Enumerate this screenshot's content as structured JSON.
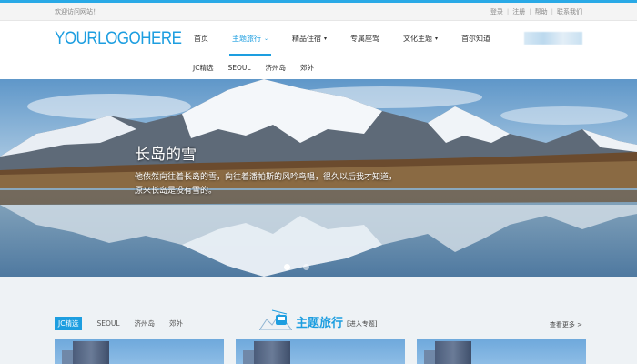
{
  "topbar": {
    "welcome": "欢迎访问网站！",
    "links": [
      "登录",
      "注册",
      "帮助",
      "联系我们"
    ]
  },
  "header": {
    "logo": "YOURLOGOHERE",
    "nav": [
      {
        "label": "首页",
        "chevron": false,
        "active": false
      },
      {
        "label": "主题旅行",
        "chevron": true,
        "active": true
      },
      {
        "label": "精品住宿",
        "chevron": true,
        "active": false
      },
      {
        "label": "专属座驾",
        "chevron": false,
        "active": false
      },
      {
        "label": "文化主题",
        "chevron": true,
        "active": false
      },
      {
        "label": "首尔知道",
        "chevron": false,
        "active": false
      }
    ]
  },
  "subnav": [
    "JC精选",
    "SEOUL",
    "济州岛",
    "郊外"
  ],
  "hero": {
    "title": "长岛的雪",
    "line1": "他依然向往着长岛的雪，向往着潘帕斯的风吟鸟唱，很久以后我才知道，",
    "line2": "原来长岛是没有雪的。",
    "slides": 2,
    "current": 1
  },
  "section": {
    "tabs": [
      "JC精选",
      "SEOUL",
      "济州岛",
      "郊外"
    ],
    "title": "主题旅行",
    "enter": "[进入专题]",
    "more": "查看更多 >"
  },
  "colors": {
    "accent": "#1d9ee0"
  },
  "icons": {
    "chevron": "chevron-down-icon",
    "theme": "mountain-cable-car-icon"
  }
}
